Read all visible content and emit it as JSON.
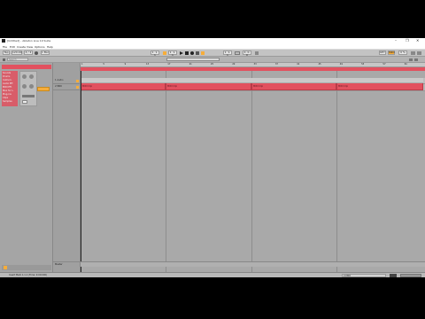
{
  "window": {
    "title": "[Untitled] - Ableton Live 10 Suite",
    "controls": [
      "–",
      "❐",
      "✕"
    ]
  },
  "menu": [
    "File",
    "Edit",
    "Create",
    "View",
    "Options",
    "Help"
  ],
  "transport": {
    "tap": "Tap",
    "tempo": "120.00",
    "time_sig": "4 / 4",
    "metro": "1 Bar",
    "position": "1. 1. 1",
    "loop_start": "1. 1. 1",
    "loop_len": "4. 0. 0",
    "key": "KEY",
    "midi": "MIDI",
    "cpu": "0 %"
  },
  "browser": {
    "search_placeholder": "Search",
    "categories": [
      "Sounds",
      "Drums",
      "Instrum.",
      "Audio Eff.",
      "MIDI Eff.",
      "Max for L.",
      "Plug-ins",
      "Clips",
      "Samples"
    ]
  },
  "arrangement": {
    "ruler": [
      "1",
      "5",
      "9",
      "13",
      "17",
      "21",
      "25",
      "29",
      "33",
      "37",
      "41",
      "45",
      "49",
      "53",
      "57",
      "61"
    ],
    "tracks": [
      {
        "name": "1 Audio",
        "clips": [
          "",
          "",
          "",
          ""
        ]
      },
      {
        "name": "2 MIDI",
        "clips": [
          "MIDI Clip",
          "MIDI Clip",
          "MIDI Clip",
          "MIDI Clip"
        ]
      }
    ],
    "master": "Master"
  },
  "status": {
    "left": "Insert Mark 1.1.1 (Time: 0:00:000)",
    "right": "2-MIDI"
  },
  "colors": {
    "accent": "#e2515f",
    "accent_orange": "#f6ad3a",
    "panel": "#a5a5a5",
    "toolbar": "#c3c3c3"
  }
}
